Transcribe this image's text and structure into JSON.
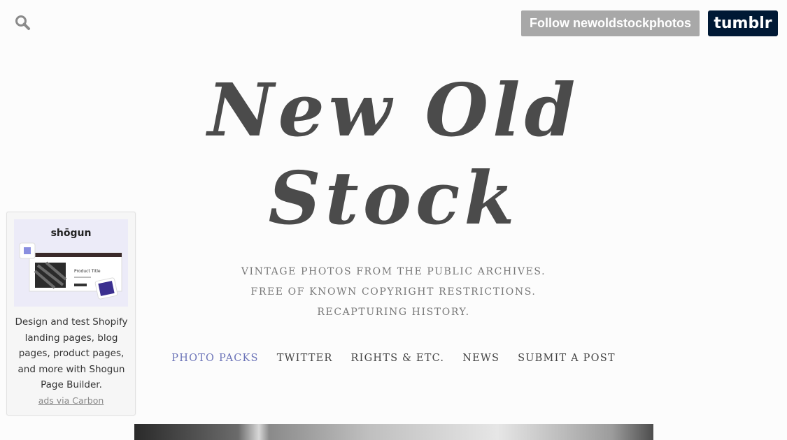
{
  "header": {
    "search_icon": "search-icon",
    "follow_label": "Follow newoldstockphotos",
    "tumblr_label": "tumblr"
  },
  "site": {
    "title_line1": "New Old",
    "title_line2": "Stock",
    "tagline": [
      "VINTAGE PHOTOS FROM THE PUBLIC ARCHIVES.",
      "FREE OF KNOWN COPYRIGHT RESTRICTIONS.",
      "RECAPTURING HISTORY."
    ]
  },
  "nav": {
    "items": [
      {
        "label": "PHOTO PACKS",
        "active": true
      },
      {
        "label": "TWITTER"
      },
      {
        "label": "RIGHTS & ETC."
      },
      {
        "label": "NEWS"
      },
      {
        "label": "SUBMIT A POST"
      }
    ]
  },
  "ad": {
    "logo": "shōgun",
    "product_title": "Product Title",
    "text": "Design and test Shopify landing pages, blog pages, product pages, and more with Shogun Page Builder.",
    "via": "ads via Carbon"
  },
  "colors": {
    "follow_bg": "#a8a8a8",
    "tumblr_bg": "#001935",
    "nav_active": "#6b73b8",
    "title": "#4b4b4b"
  }
}
